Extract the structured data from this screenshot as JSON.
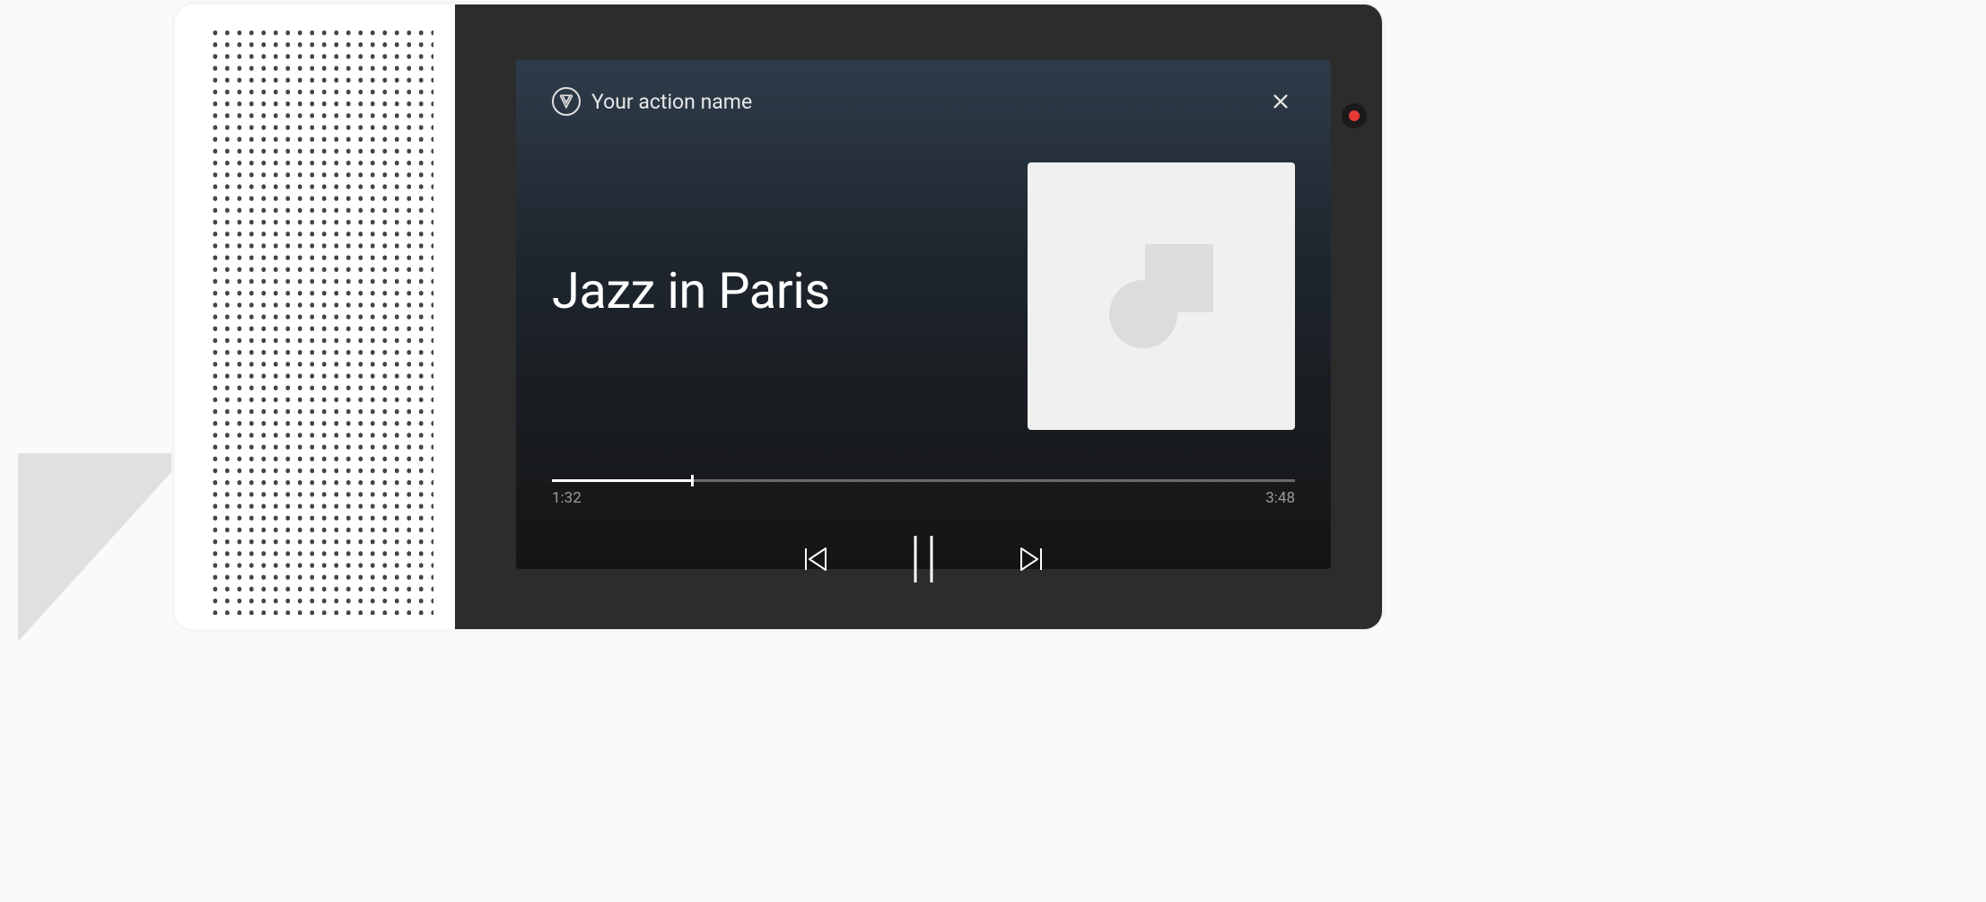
{
  "header": {
    "action_name": "Your action name",
    "app_icon": "app-logo-icon",
    "close_icon": "close-icon"
  },
  "media": {
    "track_title": "Jazz in Paris",
    "album_art_placeholder": "image-placeholder-icon"
  },
  "progress": {
    "elapsed": "1:32",
    "total": "3:48",
    "percent": 18.9
  },
  "controls": {
    "prev": "skip-previous-icon",
    "pause": "pause-icon",
    "next": "skip-next-icon"
  },
  "indicator": {
    "status": "recording"
  }
}
